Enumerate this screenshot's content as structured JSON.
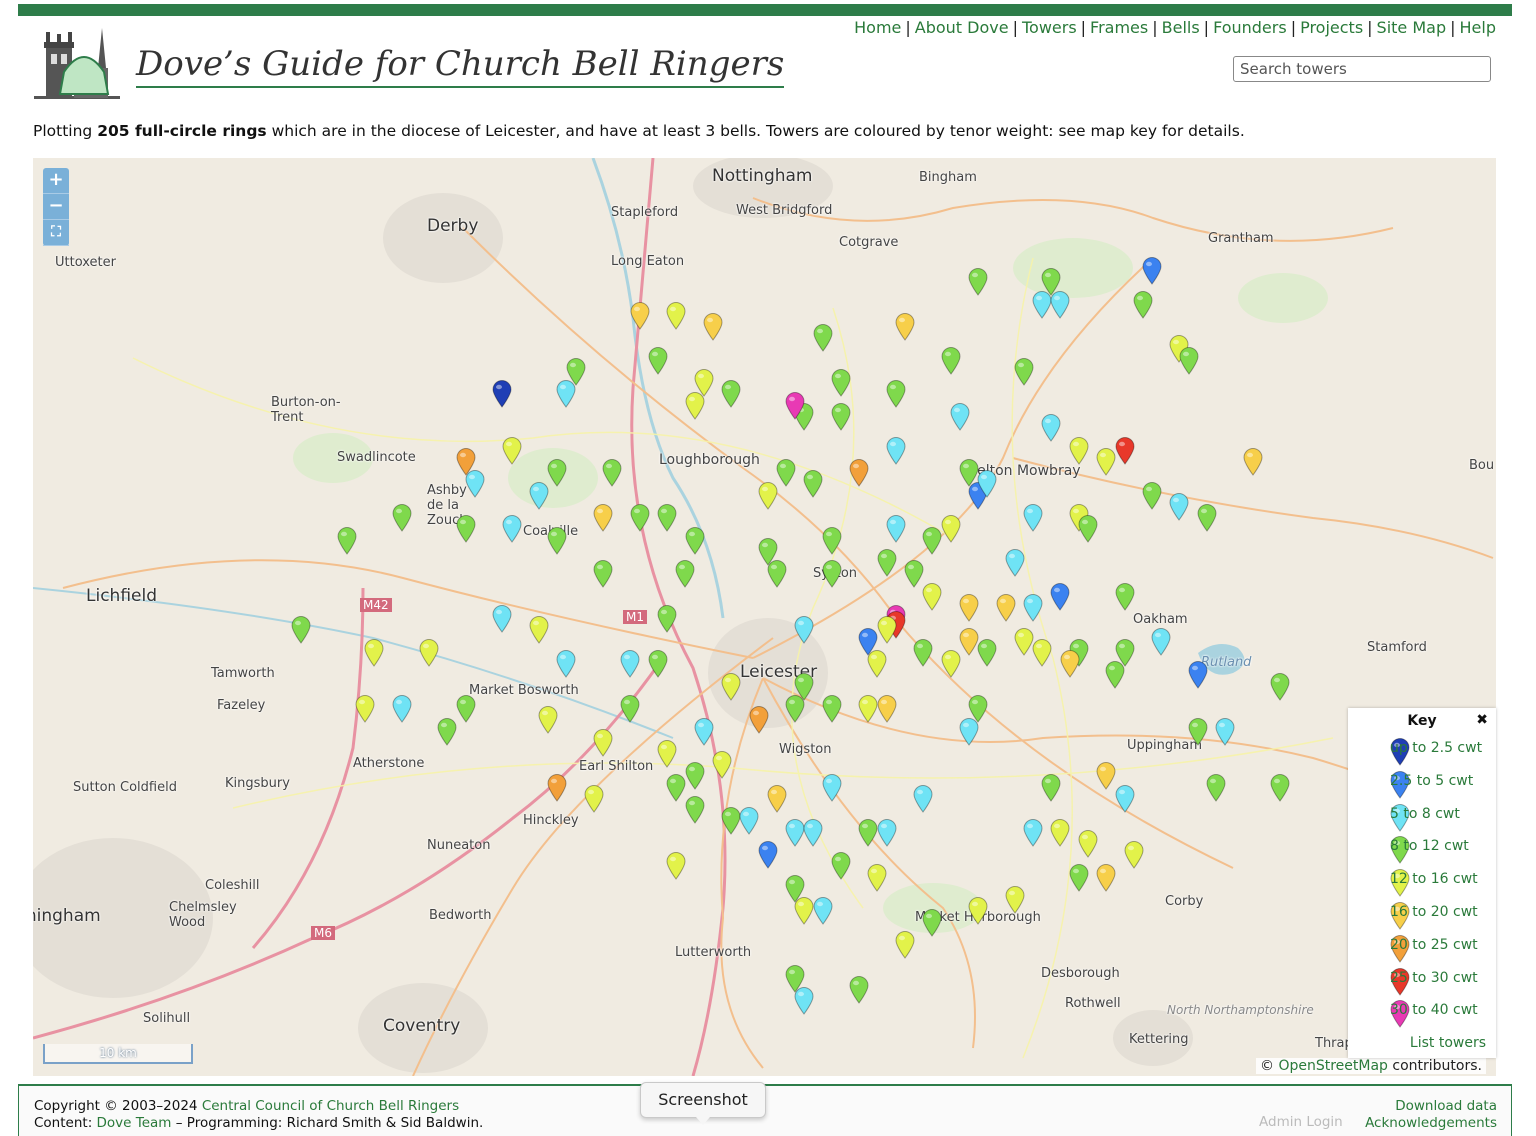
{
  "nav": [
    "Home",
    "About Dove",
    "Towers",
    "Frames",
    "Bells",
    "Founders",
    "Projects",
    "Site Map",
    "Help"
  ],
  "site_title": "Dove’s Guide for Church Bell Ringers",
  "search": {
    "placeholder": "Search towers"
  },
  "intro": {
    "prefix": "Plotting ",
    "count": "205 full-circle rings",
    "suffix": " which are in the diocese of Leicester, and have at least 3 bells. Towers are coloured by tenor weight: see map key for details."
  },
  "map": {
    "zoom_in": "+",
    "zoom_out": "−",
    "fullscreen": "⛶",
    "scale_label": "10 km",
    "places": [
      "Nottingham",
      "Bingham",
      "Derby",
      "Stapleford",
      "West Bridgford",
      "Cotgrave",
      "Grantham",
      "Uttoxeter",
      "Long Eaton",
      "Burton-on-Trent",
      "Loughborough",
      "Swadlincote",
      "Ashby de la Zouch",
      "Coalville",
      "Melton Mowbray",
      "Syston",
      "Lichfield",
      "Oakham",
      "Rutland",
      "Stamford",
      "Tamworth",
      "Leicester",
      "Market Bosworth",
      "Fazeley",
      "Wigston",
      "Atherstone",
      "Earl Shilton",
      "Uppingham",
      "Sutton Coldfield",
      "Kingsbury",
      "Hinckley",
      "Nuneaton",
      "Coleshill",
      "Chelmsley Wood",
      "Birmingham",
      "Bedworth",
      "Corby",
      "Market Harborough",
      "Lutterworth",
      "Desborough",
      "Rothwell",
      "Coventry",
      "Solihull",
      "North Northamptonshire",
      "Kettering",
      "Thrapston",
      "M42",
      "M1",
      "M6",
      "Bou"
    ],
    "colors": {
      "up to 2.5 cwt": "#1f3fb5",
      "2.5 to 5 cwt": "#3b82f0",
      "5 to 8 cwt": "#6fe3f5",
      "8 to 12 cwt": "#7fd94c",
      "12 to 16 cwt": "#e2f24a",
      "16 to 20 cwt": "#f7cf4a",
      "20 to 25 cwt": "#f2a03a",
      "25 to 30 cwt": "#e8382a",
      "30 to 40 cwt": "#e83ab4"
    },
    "towers": [
      {
        "lng": -0.78,
        "lat": 52.98,
        "cls": "20 to 25 cwt"
      },
      {
        "lng": -0.85,
        "lat": 52.86,
        "cls": "2.5 to 5 cwt"
      },
      {
        "lng": -0.96,
        "lat": 52.85,
        "cls": "8 to 12 cwt"
      },
      {
        "lng": -1.04,
        "lat": 52.85,
        "cls": "8 to 12 cwt"
      },
      {
        "lng": -0.97,
        "lat": 52.83,
        "cls": "5 to 8 cwt"
      },
      {
        "lng": -0.95,
        "lat": 52.83,
        "cls": "5 to 8 cwt"
      },
      {
        "lng": -0.86,
        "lat": 52.83,
        "cls": "8 to 12 cwt"
      },
      {
        "lng": -1.12,
        "lat": 52.81,
        "cls": "16 to 20 cwt"
      },
      {
        "lng": -1.21,
        "lat": 52.8,
        "cls": "8 to 12 cwt"
      },
      {
        "lng": -0.82,
        "lat": 52.79,
        "cls": "12 to 16 cwt"
      },
      {
        "lng": -0.81,
        "lat": 52.78,
        "cls": "8 to 12 cwt"
      },
      {
        "lng": -1.07,
        "lat": 52.78,
        "cls": "8 to 12 cwt"
      },
      {
        "lng": -0.99,
        "lat": 52.77,
        "cls": "8 to 12 cwt"
      },
      {
        "lng": -1.41,
        "lat": 52.82,
        "cls": "16 to 20 cwt"
      },
      {
        "lng": -1.37,
        "lat": 52.82,
        "cls": "12 to 16 cwt"
      },
      {
        "lng": -1.33,
        "lat": 52.81,
        "cls": "16 to 20 cwt"
      },
      {
        "lng": -1.48,
        "lat": 52.77,
        "cls": "8 to 12 cwt"
      },
      {
        "lng": -1.39,
        "lat": 52.78,
        "cls": "8 to 12 cwt"
      },
      {
        "lng": -1.34,
        "lat": 52.76,
        "cls": "12 to 16 cwt"
      },
      {
        "lng": -1.31,
        "lat": 52.75,
        "cls": "8 to 12 cwt"
      },
      {
        "lng": -1.19,
        "lat": 52.76,
        "cls": "8 to 12 cwt"
      },
      {
        "lng": -1.23,
        "lat": 52.73,
        "cls": "8 to 12 cwt"
      },
      {
        "lng": -1.13,
        "lat": 52.75,
        "cls": "8 to 12 cwt"
      },
      {
        "lng": -1.06,
        "lat": 52.73,
        "cls": "5 to 8 cwt"
      },
      {
        "lng": -0.96,
        "lat": 52.72,
        "cls": "5 to 8 cwt"
      },
      {
        "lng": -0.93,
        "lat": 52.7,
        "cls": "12 to 16 cwt"
      },
      {
        "lng": -0.9,
        "lat": 52.69,
        "cls": "12 to 16 cwt"
      },
      {
        "lng": -0.88,
        "lat": 52.7,
        "cls": "25 to 30 cwt"
      },
      {
        "lng": -0.74,
        "lat": 52.69,
        "cls": "16 to 20 cwt"
      },
      {
        "lng": -1.56,
        "lat": 52.75,
        "cls": "up to 2.5 cwt"
      },
      {
        "lng": -1.49,
        "lat": 52.75,
        "cls": "5 to 8 cwt"
      },
      {
        "lng": -1.35,
        "lat": 52.74,
        "cls": "12 to 16 cwt"
      },
      {
        "lng": -1.24,
        "lat": 52.74,
        "cls": "30 to 40 cwt"
      },
      {
        "lng": -1.19,
        "lat": 52.73,
        "cls": "8 to 12 cwt"
      },
      {
        "lng": -1.55,
        "lat": 52.7,
        "cls": "12 to 16 cwt"
      },
      {
        "lng": -1.6,
        "lat": 52.69,
        "cls": "20 to 25 cwt"
      },
      {
        "lng": -1.59,
        "lat": 52.67,
        "cls": "5 to 8 cwt"
      },
      {
        "lng": -1.5,
        "lat": 52.68,
        "cls": "8 to 12 cwt"
      },
      {
        "lng": -1.44,
        "lat": 52.68,
        "cls": "8 to 12 cwt"
      },
      {
        "lng": -1.52,
        "lat": 52.66,
        "cls": "5 to 8 cwt"
      },
      {
        "lng": -1.45,
        "lat": 52.64,
        "cls": "16 to 20 cwt"
      },
      {
        "lng": -1.41,
        "lat": 52.64,
        "cls": "8 to 12 cwt"
      },
      {
        "lng": -1.38,
        "lat": 52.64,
        "cls": "8 to 12 cwt"
      },
      {
        "lng": -1.27,
        "lat": 52.66,
        "cls": "12 to 16 cwt"
      },
      {
        "lng": -1.25,
        "lat": 52.68,
        "cls": "8 to 12 cwt"
      },
      {
        "lng": -1.22,
        "lat": 52.67,
        "cls": "8 to 12 cwt"
      },
      {
        "lng": -1.17,
        "lat": 52.68,
        "cls": "20 to 25 cwt"
      },
      {
        "lng": -1.13,
        "lat": 52.7,
        "cls": "5 to 8 cwt"
      },
      {
        "lng": -1.05,
        "lat": 52.68,
        "cls": "8 to 12 cwt"
      },
      {
        "lng": -1.04,
        "lat": 52.66,
        "cls": "2.5 to 5 cwt"
      },
      {
        "lng": -1.03,
        "lat": 52.67,
        "cls": "5 to 8 cwt"
      },
      {
        "lng": -0.98,
        "lat": 52.64,
        "cls": "5 to 8 cwt"
      },
      {
        "lng": -0.93,
        "lat": 52.64,
        "cls": "12 to 16 cwt"
      },
      {
        "lng": -0.85,
        "lat": 52.66,
        "cls": "8 to 12 cwt"
      },
      {
        "lng": -0.82,
        "lat": 52.65,
        "cls": "5 to 8 cwt"
      },
      {
        "lng": -1.67,
        "lat": 52.64,
        "cls": "8 to 12 cwt"
      },
      {
        "lng": -1.73,
        "lat": 52.62,
        "cls": "8 to 12 cwt"
      },
      {
        "lng": -1.6,
        "lat": 52.63,
        "cls": "8 to 12 cwt"
      },
      {
        "lng": -1.55,
        "lat": 52.63,
        "cls": "5 to 8 cwt"
      },
      {
        "lng": -1.5,
        "lat": 52.62,
        "cls": "8 to 12 cwt"
      },
      {
        "lng": -1.35,
        "lat": 52.62,
        "cls": "8 to 12 cwt"
      },
      {
        "lng": -1.27,
        "lat": 52.61,
        "cls": "8 to 12 cwt"
      },
      {
        "lng": -1.2,
        "lat": 52.62,
        "cls": "8 to 12 cwt"
      },
      {
        "lng": -1.13,
        "lat": 52.63,
        "cls": "5 to 8 cwt"
      },
      {
        "lng": -1.09,
        "lat": 52.62,
        "cls": "8 to 12 cwt"
      },
      {
        "lng": -1.07,
        "lat": 52.63,
        "cls": "12 to 16 cwt"
      },
      {
        "lng": -1.0,
        "lat": 52.6,
        "cls": "5 to 8 cwt"
      },
      {
        "lng": -0.92,
        "lat": 52.63,
        "cls": "8 to 12 cwt"
      },
      {
        "lng": -0.79,
        "lat": 52.64,
        "cls": "8 to 12 cwt"
      },
      {
        "lng": -1.45,
        "lat": 52.59,
        "cls": "8 to 12 cwt"
      },
      {
        "lng": -1.36,
        "lat": 52.59,
        "cls": "8 to 12 cwt"
      },
      {
        "lng": -1.26,
        "lat": 52.59,
        "cls": "8 to 12 cwt"
      },
      {
        "lng": -1.2,
        "lat": 52.59,
        "cls": "8 to 12 cwt"
      },
      {
        "lng": -1.14,
        "lat": 52.6,
        "cls": "8 to 12 cwt"
      },
      {
        "lng": -1.11,
        "lat": 52.59,
        "cls": "8 to 12 cwt"
      },
      {
        "lng": -1.09,
        "lat": 52.57,
        "cls": "12 to 16 cwt"
      },
      {
        "lng": -1.01,
        "lat": 52.56,
        "cls": "16 to 20 cwt"
      },
      {
        "lng": -0.98,
        "lat": 52.56,
        "cls": "5 to 8 cwt"
      },
      {
        "lng": -0.95,
        "lat": 52.57,
        "cls": "2.5 to 5 cwt"
      },
      {
        "lng": -0.88,
        "lat": 52.57,
        "cls": "8 to 12 cwt"
      },
      {
        "lng": -1.56,
        "lat": 52.55,
        "cls": "5 to 8 cwt"
      },
      {
        "lng": -1.38,
        "lat": 52.55,
        "cls": "8 to 12 cwt"
      },
      {
        "lng": -1.23,
        "lat": 52.54,
        "cls": "5 to 8 cwt"
      },
      {
        "lng": -1.13,
        "lat": 52.55,
        "cls": "30 to 40 cwt"
      },
      {
        "lng": -1.13,
        "lat": 52.545,
        "cls": "25 to 30 cwt"
      },
      {
        "lng": -1.14,
        "lat": 52.54,
        "cls": "12 to 16 cwt"
      },
      {
        "lng": -1.16,
        "lat": 52.53,
        "cls": "2.5 to 5 cwt"
      },
      {
        "lng": -1.05,
        "lat": 52.56,
        "cls": "16 to 20 cwt"
      },
      {
        "lng": -0.99,
        "lat": 52.53,
        "cls": "12 to 16 cwt"
      },
      {
        "lng": -0.93,
        "lat": 52.52,
        "cls": "8 to 12 cwt"
      },
      {
        "lng": -0.88,
        "lat": 52.52,
        "cls": "8 to 12 cwt"
      },
      {
        "lng": -0.84,
        "lat": 52.53,
        "cls": "5 to 8 cwt"
      },
      {
        "lng": -1.78,
        "lat": 52.54,
        "cls": "8 to 12 cwt"
      },
      {
        "lng": -1.7,
        "lat": 52.52,
        "cls": "12 to 16 cwt"
      },
      {
        "lng": -1.64,
        "lat": 52.52,
        "cls": "12 to 16 cwt"
      },
      {
        "lng": -1.52,
        "lat": 52.54,
        "cls": "12 to 16 cwt"
      },
      {
        "lng": -1.49,
        "lat": 52.51,
        "cls": "5 to 8 cwt"
      },
      {
        "lng": -1.42,
        "lat": 52.51,
        "cls": "5 to 8 cwt"
      },
      {
        "lng": -1.39,
        "lat": 52.51,
        "cls": "8 to 12 cwt"
      },
      {
        "lng": -1.31,
        "lat": 52.49,
        "cls": "12 to 16 cwt"
      },
      {
        "lng": -1.23,
        "lat": 52.49,
        "cls": "8 to 12 cwt"
      },
      {
        "lng": -1.15,
        "lat": 52.51,
        "cls": "12 to 16 cwt"
      },
      {
        "lng": -1.1,
        "lat": 52.52,
        "cls": "8 to 12 cwt"
      },
      {
        "lng": -1.07,
        "lat": 52.51,
        "cls": "12 to 16 cwt"
      },
      {
        "lng": -1.05,
        "lat": 52.53,
        "cls": "16 to 20 cwt"
      },
      {
        "lng": -1.03,
        "lat": 52.52,
        "cls": "8 to 12 cwt"
      },
      {
        "lng": -0.97,
        "lat": 52.52,
        "cls": "12 to 16 cwt"
      },
      {
        "lng": -0.94,
        "lat": 52.51,
        "cls": "16 to 20 cwt"
      },
      {
        "lng": -0.89,
        "lat": 52.5,
        "cls": "8 to 12 cwt"
      },
      {
        "lng": -0.8,
        "lat": 52.5,
        "cls": "2.5 to 5 cwt"
      },
      {
        "lng": -0.71,
        "lat": 52.49,
        "cls": "8 to 12 cwt"
      },
      {
        "lng": -1.71,
        "lat": 52.47,
        "cls": "12 to 16 cwt"
      },
      {
        "lng": -1.67,
        "lat": 52.47,
        "cls": "5 to 8 cwt"
      },
      {
        "lng": -1.6,
        "lat": 52.47,
        "cls": "8 to 12 cwt"
      },
      {
        "lng": -1.51,
        "lat": 52.46,
        "cls": "12 to 16 cwt"
      },
      {
        "lng": -1.42,
        "lat": 52.47,
        "cls": "8 to 12 cwt"
      },
      {
        "lng": -1.34,
        "lat": 52.45,
        "cls": "5 to 8 cwt"
      },
      {
        "lng": -1.28,
        "lat": 52.46,
        "cls": "20 to 25 cwt"
      },
      {
        "lng": -1.24,
        "lat": 52.47,
        "cls": "8 to 12 cwt"
      },
      {
        "lng": -1.2,
        "lat": 52.47,
        "cls": "8 to 12 cwt"
      },
      {
        "lng": -1.16,
        "lat": 52.47,
        "cls": "12 to 16 cwt"
      },
      {
        "lng": -1.14,
        "lat": 52.47,
        "cls": "16 to 20 cwt"
      },
      {
        "lng": -1.04,
        "lat": 52.47,
        "cls": "8 to 12 cwt"
      },
      {
        "lng": -1.05,
        "lat": 52.45,
        "cls": "5 to 8 cwt"
      },
      {
        "lng": -0.8,
        "lat": 52.45,
        "cls": "8 to 12 cwt"
      },
      {
        "lng": -0.77,
        "lat": 52.45,
        "cls": "5 to 8 cwt"
      },
      {
        "lng": -1.62,
        "lat": 52.45,
        "cls": "8 to 12 cwt"
      },
      {
        "lng": -1.45,
        "lat": 52.44,
        "cls": "12 to 16 cwt"
      },
      {
        "lng": -1.38,
        "lat": 52.43,
        "cls": "12 to 16 cwt"
      },
      {
        "lng": -1.35,
        "lat": 52.41,
        "cls": "8 to 12 cwt"
      },
      {
        "lng": -1.32,
        "lat": 52.42,
        "cls": "12 to 16 cwt"
      },
      {
        "lng": -1.5,
        "lat": 52.4,
        "cls": "20 to 25 cwt"
      },
      {
        "lng": -1.46,
        "lat": 52.39,
        "cls": "12 to 16 cwt"
      },
      {
        "lng": -1.37,
        "lat": 52.4,
        "cls": "8 to 12 cwt"
      },
      {
        "lng": -1.35,
        "lat": 52.38,
        "cls": "8 to 12 cwt"
      },
      {
        "lng": -1.26,
        "lat": 52.39,
        "cls": "16 to 20 cwt"
      },
      {
        "lng": -1.2,
        "lat": 52.4,
        "cls": "5 to 8 cwt"
      },
      {
        "lng": -1.1,
        "lat": 52.39,
        "cls": "5 to 8 cwt"
      },
      {
        "lng": -0.96,
        "lat": 52.4,
        "cls": "8 to 12 cwt"
      },
      {
        "lng": -0.9,
        "lat": 52.41,
        "cls": "16 to 20 cwt"
      },
      {
        "lng": -0.88,
        "lat": 52.39,
        "cls": "5 to 8 cwt"
      },
      {
        "lng": -0.78,
        "lat": 52.4,
        "cls": "8 to 12 cwt"
      },
      {
        "lng": -0.71,
        "lat": 52.4,
        "cls": "8 to 12 cwt"
      },
      {
        "lng": -1.31,
        "lat": 52.37,
        "cls": "8 to 12 cwt"
      },
      {
        "lng": -1.29,
        "lat": 52.37,
        "cls": "5 to 8 cwt"
      },
      {
        "lng": -1.24,
        "lat": 52.36,
        "cls": "5 to 8 cwt"
      },
      {
        "lng": -1.22,
        "lat": 52.36,
        "cls": "5 to 8 cwt"
      },
      {
        "lng": -1.16,
        "lat": 52.36,
        "cls": "8 to 12 cwt"
      },
      {
        "lng": -1.14,
        "lat": 52.36,
        "cls": "5 to 8 cwt"
      },
      {
        "lng": -0.98,
        "lat": 52.36,
        "cls": "5 to 8 cwt"
      },
      {
        "lng": -0.95,
        "lat": 52.36,
        "cls": "12 to 16 cwt"
      },
      {
        "lng": -0.92,
        "lat": 52.35,
        "cls": "12 to 16 cwt"
      },
      {
        "lng": -1.27,
        "lat": 52.34,
        "cls": "2.5 to 5 cwt"
      },
      {
        "lng": -1.37,
        "lat": 52.33,
        "cls": "12 to 16 cwt"
      },
      {
        "lng": -1.19,
        "lat": 52.33,
        "cls": "8 to 12 cwt"
      },
      {
        "lng": -1.15,
        "lat": 52.32,
        "cls": "12 to 16 cwt"
      },
      {
        "lng": -0.93,
        "lat": 52.32,
        "cls": "8 to 12 cwt"
      },
      {
        "lng": -0.9,
        "lat": 52.32,
        "cls": "16 to 20 cwt"
      },
      {
        "lng": -0.87,
        "lat": 52.34,
        "cls": "12 to 16 cwt"
      },
      {
        "lng": -1.24,
        "lat": 52.31,
        "cls": "8 to 12 cwt"
      },
      {
        "lng": -1.23,
        "lat": 52.29,
        "cls": "12 to 16 cwt"
      },
      {
        "lng": -1.21,
        "lat": 52.29,
        "cls": "5 to 8 cwt"
      },
      {
        "lng": -1.04,
        "lat": 52.29,
        "cls": "12 to 16 cwt"
      },
      {
        "lng": -1.0,
        "lat": 52.3,
        "cls": "12 to 16 cwt"
      },
      {
        "lng": -1.09,
        "lat": 52.28,
        "cls": "8 to 12 cwt"
      },
      {
        "lng": -1.12,
        "lat": 52.26,
        "cls": "12 to 16 cwt"
      },
      {
        "lng": -1.24,
        "lat": 52.23,
        "cls": "8 to 12 cwt"
      },
      {
        "lng": -1.23,
        "lat": 52.21,
        "cls": "5 to 8 cwt"
      },
      {
        "lng": -1.17,
        "lat": 52.22,
        "cls": "8 to 12 cwt"
      }
    ]
  },
  "key": {
    "title": "Key",
    "close": "✖",
    "items": [
      {
        "label": "up to 2.5 cwt",
        "color": "#1f3fb5"
      },
      {
        "label": "2.5 to 5 cwt",
        "color": "#3b82f0"
      },
      {
        "label": "5 to 8 cwt",
        "color": "#6fe3f5"
      },
      {
        "label": "8 to 12 cwt",
        "color": "#7fd94c"
      },
      {
        "label": "12 to 16 cwt",
        "color": "#e2f24a"
      },
      {
        "label": "16 to 20 cwt",
        "color": "#f7cf4a"
      },
      {
        "label": "20 to 25 cwt",
        "color": "#f2a03a"
      },
      {
        "label": "25 to 30 cwt",
        "color": "#e8382a"
      },
      {
        "label": "30 to 40 cwt",
        "color": "#e83ab4"
      }
    ],
    "list_link": "List towers"
  },
  "attribution": {
    "symbol": "©",
    "link": "OpenStreetMap",
    "suffix": " contributors."
  },
  "footer": {
    "copyright_prefix": "Copyright © 2003–2024 ",
    "copyright_link": "Central Council of Church Bell Ringers",
    "content_prefix": "Content: ",
    "content_link": "Dove Team",
    "content_suffix": " – Programming: Richard Smith & Sid Baldwin.",
    "admin": "Admin Login",
    "download": "Download data",
    "acknowledgements": "Acknowledgements"
  },
  "tooltip": "Screenshot"
}
